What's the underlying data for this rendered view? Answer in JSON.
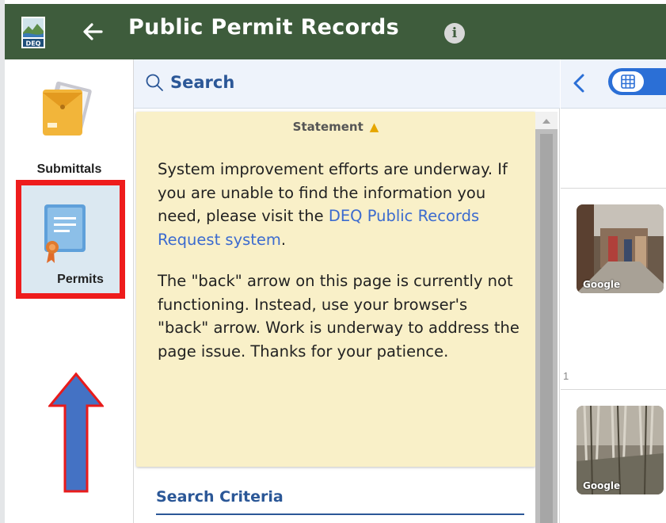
{
  "header": {
    "title": "Public Permit Records",
    "logo_text": "DEQ",
    "info_glyph": "i",
    "back_icon": "arrow-left-icon",
    "background": "#3e5c3c"
  },
  "leftnav": {
    "items": [
      {
        "label": "Submittals",
        "icon": "envelope-folder-icon"
      },
      {
        "label": "Permits",
        "icon": "certificate-icon",
        "selected": true
      }
    ],
    "highlight_color": "#ee1c1c",
    "annotation_arrow_color": "#4472c4"
  },
  "search": {
    "label": "Search",
    "icon": "search-icon"
  },
  "statement": {
    "header": "Statement",
    "caret": "^",
    "paragraph1_text": "System improvement efforts are underway. If you are unable to find the information you need, please visit the ",
    "paragraph1_link": "DEQ Public Records Request system",
    "paragraph1_end": ".",
    "paragraph2": "The \"back\" arrow on this page is currently not functioning. Instead, use your browser's \"back\" arrow. Work is underway to address the page issue. Thanks for your patience."
  },
  "criteria": {
    "title": "Search Criteria"
  },
  "results": {
    "back_icon": "chevron-left-icon",
    "view_icon": "grid-icon",
    "row_number": "1",
    "thumbnails": [
      {
        "tag": "Google"
      },
      {
        "tag": "Google"
      }
    ],
    "accent": "#2b6fd6"
  }
}
